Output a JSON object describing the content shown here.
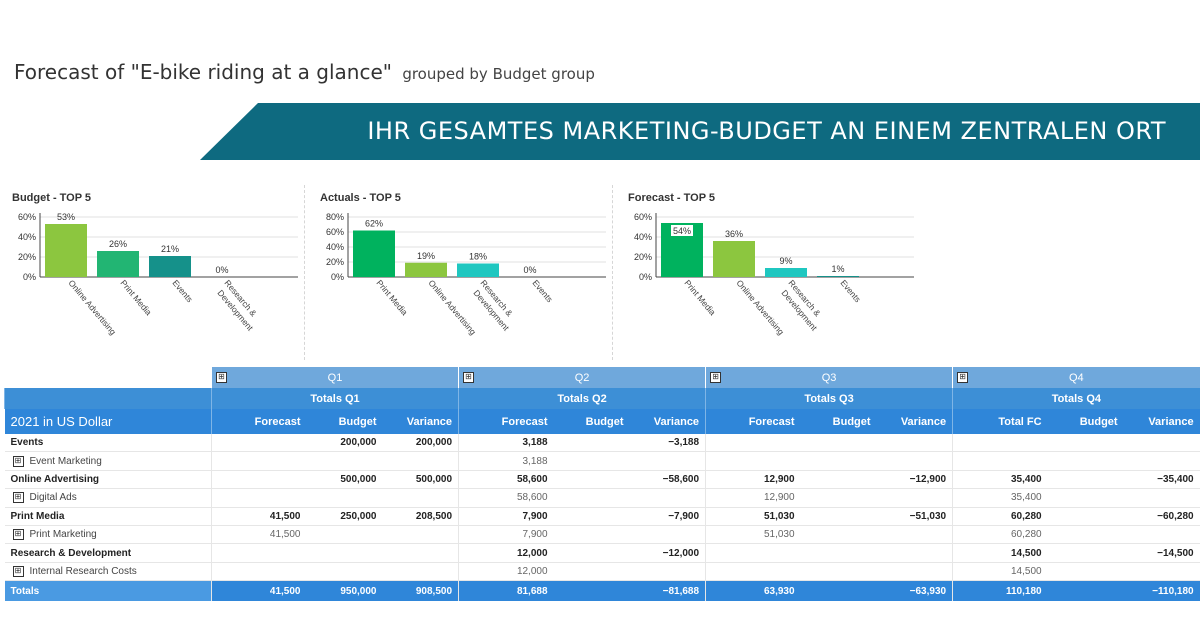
{
  "report": {
    "title": "Forecast of \"E-bike riding at a glance\"",
    "subtitle": "grouped by Budget group"
  },
  "banner": {
    "text": "IHR GESAMTES MARKETING-BUDGET AN EINEM ZENTRALEN ORT"
  },
  "chart_data": [
    {
      "type": "bar",
      "title": "Budget - TOP 5",
      "categories": [
        "Online Advertising",
        "Print Media",
        "Events",
        "Research & Development"
      ],
      "values": [
        53,
        26,
        21,
        0
      ],
      "value_labels": [
        "53%",
        "26%",
        "21%",
        "0%"
      ],
      "yticks": [
        "0%",
        "20%",
        "40%",
        "60%"
      ],
      "ylim": [
        0,
        60
      ],
      "colors": [
        "#8cc63f",
        "#22b573",
        "#15918a",
        "#15a0a0"
      ]
    },
    {
      "type": "bar",
      "title": "Actuals - TOP 5",
      "categories": [
        "Print Media",
        "Online Advertising",
        "Research & Development",
        "Events"
      ],
      "values": [
        62,
        19,
        18,
        0
      ],
      "value_labels": [
        "62%",
        "19%",
        "18%",
        "0%"
      ],
      "yticks": [
        "0%",
        "20%",
        "40%",
        "60%",
        "80%"
      ],
      "ylim": [
        0,
        80
      ],
      "colors": [
        "#00b25e",
        "#8cc63f",
        "#1fc7c0",
        "#15918a"
      ]
    },
    {
      "type": "bar",
      "title": "Forecast - TOP 5",
      "categories": [
        "Print Media",
        "Online Advertising",
        "Research & Development",
        "Events"
      ],
      "values": [
        54,
        36,
        9,
        1
      ],
      "value_labels": [
        "54%",
        "36%",
        "9%",
        "1%"
      ],
      "yticks": [
        "0%",
        "20%",
        "40%",
        "60%"
      ],
      "ylim": [
        0,
        60
      ],
      "colors": [
        "#00b25e",
        "#8cc63f",
        "#1fc7c0",
        "#15918a"
      ]
    }
  ],
  "colors": {
    "header_dark": "#2f86d9",
    "header_light": "#6fa8dc",
    "banner": "#0e6a80"
  },
  "table": {
    "expander_symbol": "⊞",
    "quarters": [
      {
        "label": "Q1",
        "totals": "Totals Q1",
        "cols": [
          "Forecast",
          "Budget",
          "Variance"
        ]
      },
      {
        "label": "Q2",
        "totals": "Totals Q2",
        "cols": [
          "Forecast",
          "Budget",
          "Variance"
        ]
      },
      {
        "label": "Q3",
        "totals": "Totals Q3",
        "cols": [
          "Forecast",
          "Budget",
          "Variance"
        ]
      },
      {
        "label": "Q4",
        "totals": "Totals Q4",
        "cols": [
          "Total FC",
          "Budget",
          "Variance"
        ]
      }
    ],
    "corner_label": "2021 in US Dollar",
    "rows": [
      {
        "label": "Events",
        "type": "group",
        "cells": [
          "",
          "200,000",
          "200,000",
          "3,188",
          "",
          "−3,188",
          "",
          "",
          "",
          "",
          "",
          ""
        ]
      },
      {
        "label": "Event Marketing",
        "type": "sub",
        "cells": [
          "",
          "",
          "",
          "3,188",
          "",
          "",
          "",
          "",
          "",
          "",
          "",
          ""
        ]
      },
      {
        "label": "Online Advertising",
        "type": "group",
        "cells": [
          "",
          "500,000",
          "500,000",
          "58,600",
          "",
          "−58,600",
          "12,900",
          "",
          "−12,900",
          "35,400",
          "",
          "−35,400"
        ]
      },
      {
        "label": "Digital Ads",
        "type": "sub",
        "cells": [
          "",
          "",
          "",
          "58,600",
          "",
          "",
          "12,900",
          "",
          "",
          "35,400",
          "",
          ""
        ]
      },
      {
        "label": "Print Media",
        "type": "group",
        "cells": [
          "41,500",
          "250,000",
          "208,500",
          "7,900",
          "",
          "−7,900",
          "51,030",
          "",
          "−51,030",
          "60,280",
          "",
          "−60,280"
        ]
      },
      {
        "label": "Print Marketing",
        "type": "sub",
        "cells": [
          "41,500",
          "",
          "",
          "7,900",
          "",
          "",
          "51,030",
          "",
          "",
          "60,280",
          "",
          ""
        ]
      },
      {
        "label": "Research & Development",
        "type": "group",
        "cells": [
          "",
          "",
          "",
          "12,000",
          "",
          "−12,000",
          "",
          "",
          "",
          "14,500",
          "",
          "−14,500"
        ]
      },
      {
        "label": "Internal Research Costs",
        "type": "sub",
        "cells": [
          "",
          "",
          "",
          "12,000",
          "",
          "",
          "",
          "",
          "",
          "14,500",
          "",
          ""
        ]
      }
    ],
    "totals": {
      "label": "Totals",
      "cells": [
        "41,500",
        "950,000",
        "908,500",
        "81,688",
        "",
        "−81,688",
        "63,930",
        "",
        "−63,930",
        "110,180",
        "",
        "−110,180"
      ]
    }
  }
}
